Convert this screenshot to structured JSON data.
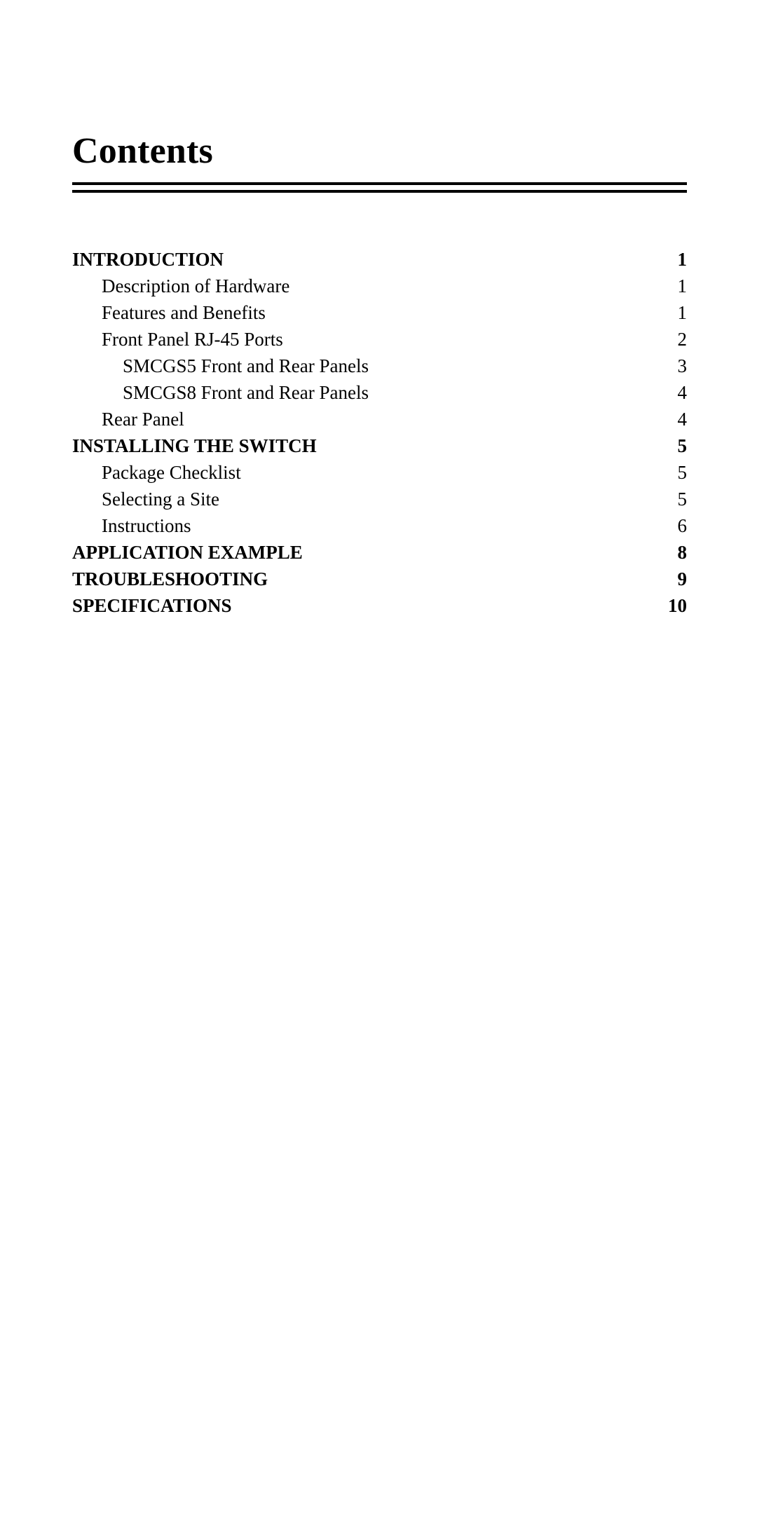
{
  "page": {
    "background_color": "#ffffff",
    "text_color": "#000000"
  },
  "header": {
    "title": "Contents"
  },
  "toc": {
    "entries": [
      {
        "label": "INTRODUCTION",
        "page": "1",
        "level": 0
      },
      {
        "label": "Description of Hardware",
        "page": "1",
        "level": 1
      },
      {
        "label": "Features and Benefits",
        "page": "1",
        "level": 1
      },
      {
        "label": "Front Panel RJ-45 Ports",
        "page": "2",
        "level": 1
      },
      {
        "label": "SMCGS5 Front and Rear Panels",
        "page": "3",
        "level": 2
      },
      {
        "label": "SMCGS8 Front and Rear Panels",
        "page": "4",
        "level": 2
      },
      {
        "label": "Rear Panel",
        "page": "4",
        "level": 1
      },
      {
        "label": "INSTALLING THE SWITCH",
        "page": "5",
        "level": 0
      },
      {
        "label": "Package Checklist",
        "page": "5",
        "level": 1
      },
      {
        "label": "Selecting a Site",
        "page": "5",
        "level": 1
      },
      {
        "label": "Instructions",
        "page": "6",
        "level": 1
      },
      {
        "label": "APPLICATION EXAMPLE",
        "page": "8",
        "level": 0
      },
      {
        "label": "TROUBLESHOOTING",
        "page": "9",
        "level": 0
      },
      {
        "label": "SPECIFICATIONS",
        "page": "10",
        "level": 0
      }
    ]
  }
}
